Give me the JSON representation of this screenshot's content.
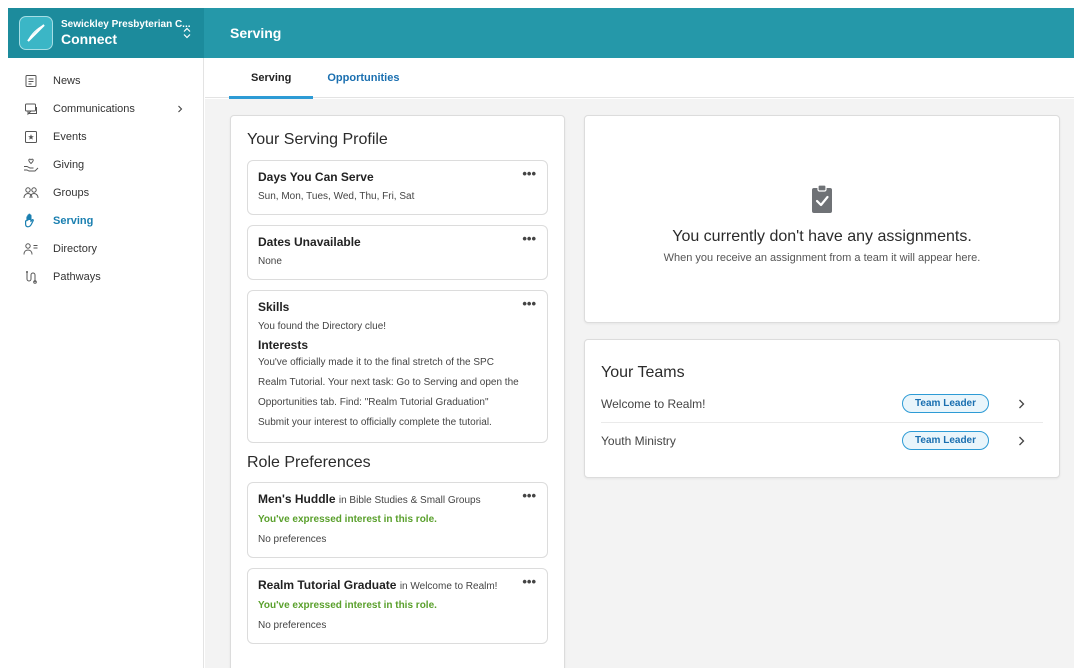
{
  "app": {
    "org_name": "Sewickley Presbyterian C...",
    "app_name": "Connect"
  },
  "header": {
    "title": "Serving"
  },
  "colors": {
    "brand": "#2598a9",
    "accent": "#2d9bd5",
    "active_text": "#1a7fb0",
    "success": "#5aa02c"
  },
  "sidebar": {
    "items": [
      {
        "label": "News",
        "icon": "news-icon"
      },
      {
        "label": "Communications",
        "icon": "chat-icon",
        "has_submenu": true
      },
      {
        "label": "Events",
        "icon": "calendar-star-icon"
      },
      {
        "label": "Giving",
        "icon": "giving-hand-icon"
      },
      {
        "label": "Groups",
        "icon": "groups-icon"
      },
      {
        "label": "Serving",
        "icon": "hand-icon",
        "active": true
      },
      {
        "label": "Directory",
        "icon": "directory-icon"
      },
      {
        "label": "Pathways",
        "icon": "pathways-icon"
      }
    ]
  },
  "tabs": [
    {
      "label": "Serving",
      "active": true
    },
    {
      "label": "Opportunities"
    }
  ],
  "profile": {
    "title": "Your Serving Profile",
    "days": {
      "title": "Days You Can Serve",
      "value": "Sun, Mon, Tues, Wed, Thu, Fri, Sat"
    },
    "unavailable": {
      "title": "Dates Unavailable",
      "value": "None"
    },
    "skills": {
      "title": "Skills",
      "value": "You found the Directory clue!",
      "interests_title": "Interests",
      "interests_lines": [
        "You've officially made it to the final stretch of the SPC",
        "Realm Tutorial. Your next task: Go to Serving and open the",
        "Opportunities tab. Find: \"Realm Tutorial Graduation\"",
        "Submit your interest to officially complete the tutorial."
      ]
    },
    "role_preferences_title": "Role Preferences",
    "roles": [
      {
        "name": "Men's Huddle",
        "ministry": "in Bible Studies & Small Groups",
        "status": "You've expressed interest in this role.",
        "preferences": "No preferences"
      },
      {
        "name": "Realm Tutorial Graduate",
        "ministry": "in Welcome to Realm!",
        "status": "You've expressed interest in this role.",
        "preferences": "No preferences"
      }
    ]
  },
  "assignments": {
    "title": "You currently don't have any assignments.",
    "subtitle": "When you receive an assignment from a team it will appear here."
  },
  "teams": {
    "title": "Your Teams",
    "items": [
      {
        "name": "Welcome to Realm!",
        "badge": "Team Leader"
      },
      {
        "name": "Youth Ministry",
        "badge": "Team Leader"
      }
    ]
  }
}
